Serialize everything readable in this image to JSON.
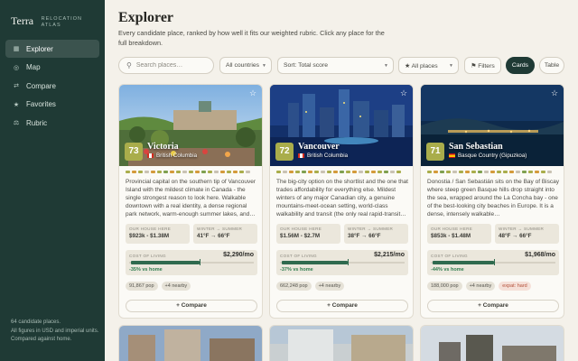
{
  "sidebar": {
    "brand": "Terra",
    "brand_sub1": "RELOCATION",
    "brand_sub2": "ATLAS",
    "items": [
      {
        "label": "Explorer",
        "icon": "grid-icon",
        "glyph": "▦",
        "active": true
      },
      {
        "label": "Map",
        "icon": "map-pin-icon",
        "glyph": "◎",
        "active": false
      },
      {
        "label": "Compare",
        "icon": "compare-arrows-icon",
        "glyph": "⇄",
        "active": false
      },
      {
        "label": "Favorites",
        "icon": "star-icon",
        "glyph": "★",
        "active": false
      },
      {
        "label": "Rubric",
        "icon": "scale-icon",
        "glyph": "⚖",
        "active": false
      }
    ],
    "footer": [
      "64 candidate places.",
      "All figures in USD and imperial units.",
      "Compared against home."
    ]
  },
  "header": {
    "title": "Explorer",
    "description": "Every candidate place, ranked by how well it fits our weighted rubric. Click any place for the full breakdown."
  },
  "toolbar": {
    "search_placeholder": "Search places…",
    "country": "All countries",
    "sort": "Sort: Total score",
    "places": "★ All places",
    "filters": "⚑ Filters",
    "cards": "Cards",
    "table": "Table"
  },
  "labels": {
    "house": "OUR HOUSE HERE",
    "winter": "WINTER → SUMMER",
    "col": "COST OF LIVING",
    "compare": "+ Compare"
  },
  "colors": {
    "sidebar_bg": "#1f3a35",
    "score_bg": "#a9ad4b",
    "savings_green": "#2f7d4f"
  },
  "cards": [
    {
      "score": "73",
      "name": "Victoria",
      "region": "British Columbia",
      "flag": "canada",
      "desc": "Provincial capital on the southern tip of Vancouver Island with the mildest climate in Canada - the single strongest reason to look here. Walkable downtown with a real identity, a dense regional park network, warm-enough summer lakes, and…",
      "house": "$923k - $1.38M",
      "winter": "41°F → 66°F",
      "col": "$2,290/mo",
      "col_fraction": 0.55,
      "pct": "-35% vs home",
      "chips": [
        {
          "text": "91,867 pop",
          "warn": false
        },
        {
          "text": "+4 nearby",
          "warn": false
        }
      ],
      "bars": [
        "#a9ad4b",
        "#d49a3a",
        "#a9ad4b",
        "#c9c2b3",
        "#d49a3a",
        "#a9ad4b",
        "#7fa04f",
        "#d49a3a",
        "#a9ad4b",
        "#c9c2b3",
        "#a9ad4b",
        "#d49a3a",
        "#7fa04f",
        "#a9ad4b",
        "#c9c2b3",
        "#d49a3a",
        "#a9ad4b",
        "#d49a3a",
        "#a9ad4b",
        "#c9c2b3"
      ]
    },
    {
      "score": "72",
      "name": "Vancouver",
      "region": "British Columbia",
      "flag": "canada",
      "desc": "The big-city option on the shortlist and the one that trades affordability for everything else. Mildest winters of any major Canadian city, a genuine mountains-meet-ocean setting, world-class walkability and transit (the only real rapid-transit…",
      "house": "$1.56M - $2.7M",
      "winter": "38°F → 66°F",
      "col": "$2,215/mo",
      "col_fraction": 0.53,
      "pct": "-37% vs home",
      "chips": [
        {
          "text": "662,248 pop",
          "warn": false
        },
        {
          "text": "+4 nearby",
          "warn": false
        }
      ],
      "bars": [
        "#a9ad4b",
        "#c9c2b3",
        "#d49a3a",
        "#a9ad4b",
        "#7fa04f",
        "#d49a3a",
        "#a9ad4b",
        "#c9c2b3",
        "#a9ad4b",
        "#d49a3a",
        "#7fa04f",
        "#a9ad4b",
        "#d49a3a",
        "#c9c2b3",
        "#a9ad4b",
        "#d49a3a",
        "#a9ad4b",
        "#7fa04f",
        "#c9c2b3",
        "#a9ad4b"
      ]
    },
    {
      "score": "71",
      "name": "San Sebastian",
      "region": "Basque Country (Gipuzkoa)",
      "flag": "spain",
      "desc": "Donostia / San Sebastián sits on the Bay of Biscay where steep green Basque hills drop straight into the sea, wrapped around the La Concha bay - one of the best-looking city beaches in Europe. It is a dense, intensely walkable…",
      "house": "$853k - $1.48M",
      "winter": "48°F → 66°F",
      "col": "$1,968/mo",
      "col_fraction": 0.49,
      "pct": "-44% vs home",
      "chips": [
        {
          "text": "188,000 pop",
          "warn": false
        },
        {
          "text": "+4 nearby",
          "warn": false
        },
        {
          "text": "expat: hard",
          "warn": true
        }
      ],
      "bars": [
        "#a9ad4b",
        "#d49a3a",
        "#7fa04f",
        "#a9ad4b",
        "#c9c2b3",
        "#a9ad4b",
        "#d49a3a",
        "#a9ad4b",
        "#7fa04f",
        "#c9c2b3",
        "#d49a3a",
        "#a9ad4b",
        "#a9ad4b",
        "#d49a3a",
        "#c9c2b3",
        "#7fa04f",
        "#a9ad4b",
        "#d49a3a",
        "#a9ad4b",
        "#c9c2b3"
      ]
    }
  ]
}
